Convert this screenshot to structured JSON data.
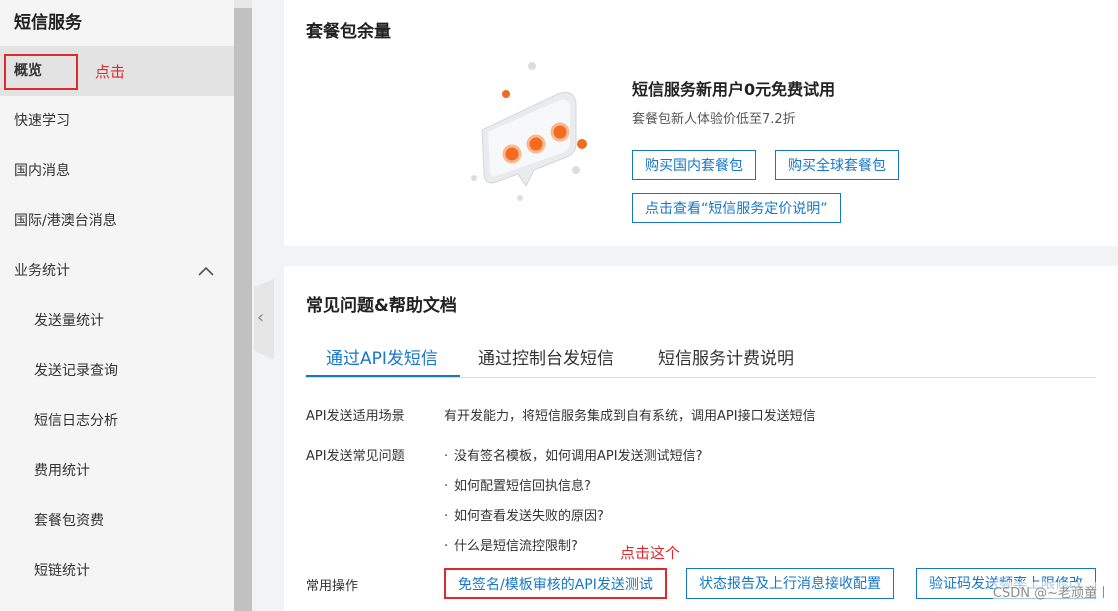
{
  "sidebar": {
    "title": "短信服务",
    "items": [
      {
        "label": "概览"
      },
      {
        "label": "快速学习"
      },
      {
        "label": "国内消息"
      },
      {
        "label": "国际/港澳台消息"
      },
      {
        "label": "业务统计",
        "chevron": "∧"
      },
      {
        "label": "发送量统计"
      },
      {
        "label": "发送记录查询"
      },
      {
        "label": "短信日志分析"
      },
      {
        "label": "费用统计"
      },
      {
        "label": "套餐包资费"
      },
      {
        "label": "短链统计"
      }
    ],
    "annotation": "点击"
  },
  "collapse_icon": "chevron-left-icon",
  "package": {
    "title": "套餐包余量",
    "promo_title": "短信服务新用户0元免费试用",
    "promo_sub": "套餐包新人体验价低至7.2折",
    "buttons": [
      "购买国内套餐包",
      "购买全球套餐包",
      "点击查看“短信服务定价说明”"
    ]
  },
  "help": {
    "title": "常见问题&帮助文档",
    "tabs": [
      "通过API发短信",
      "通过控制台发短信",
      "短信服务计费说明"
    ],
    "scenario_label": "API发送适用场景",
    "scenario_text": "有开发能力，将短信服务集成到自有系统，调用API接口发送短信",
    "faq_label": "API发送常见问题",
    "faq": [
      "没有签名模板，如何调用API发送测试短信?",
      "如何配置短信回执信息?",
      "如何查看发送失败的原因?",
      "什么是短信流控限制?"
    ],
    "ops_label": "常用操作",
    "ops": [
      "免签名/模板审核的API发送测试",
      "状态报告及上行消息接收配置",
      "验证码发送频率上限修改"
    ],
    "annotation": "点击这个"
  },
  "watermark": "CSDN @~老顽童丨",
  "colors": {
    "accent": "#1677c9",
    "annotation_red": "#e0282e"
  }
}
